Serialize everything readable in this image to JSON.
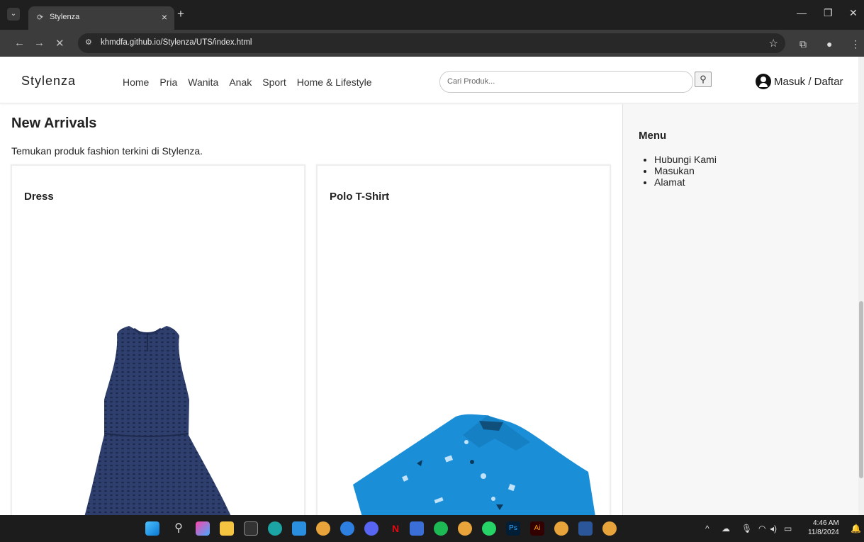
{
  "browser": {
    "tab_title": "Stylenza",
    "url": "khmdfa.github.io/Stylenza/UTS/index.html"
  },
  "navbar": {
    "brand": "Stylenza",
    "links": [
      "Home",
      "Pria",
      "Wanita",
      "Anak",
      "Sport",
      "Home & Lifestyle"
    ],
    "search_placeholder": "Cari Produk...",
    "login": "Masuk / Daftar"
  },
  "main": {
    "title": "New Arrivals",
    "subtitle": "Temukan produk fashion terkini di Stylenza.",
    "products": [
      {
        "name": "Dress",
        "color": "#2e3f6e"
      },
      {
        "name": "Polo T-Shirt",
        "color": "#1a8fd8"
      }
    ]
  },
  "sidebar": {
    "title": "Menu",
    "items": [
      "Hubungi Kami",
      "Masukan",
      "Alamat"
    ]
  },
  "taskbar": {
    "time": "4:46 AM",
    "date": "11/8/2024"
  }
}
